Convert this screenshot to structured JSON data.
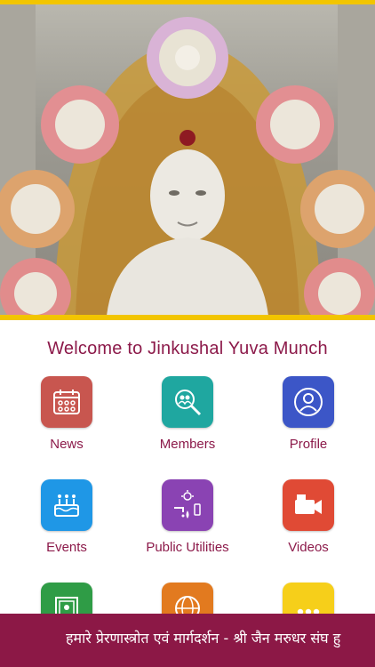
{
  "welcome_title": "Welcome to Jinkushal Yuva Munch",
  "menu": [
    {
      "label": "News",
      "icon": "calendar-icon",
      "color": "#c8564f"
    },
    {
      "label": "Members",
      "icon": "people-search-icon",
      "color": "#1fa7a0"
    },
    {
      "label": "Profile",
      "icon": "user-icon",
      "color": "#3c56c7"
    },
    {
      "label": "Events",
      "icon": "birthday-cake-icon",
      "color": "#1f97e6"
    },
    {
      "label": "Public Utilities",
      "icon": "utilities-icon",
      "color": "#8a43b3"
    },
    {
      "label": "Videos",
      "icon": "video-camera-icon",
      "color": "#e04a35"
    },
    {
      "label": "",
      "icon": "photo-gallery-icon",
      "color": "#2f9c46"
    },
    {
      "label": "",
      "icon": "globe-www-icon",
      "color": "#e27a1f"
    },
    {
      "label": "",
      "icon": "more-dots-icon",
      "color": "#f6cf1a"
    }
  ],
  "ticker_text": "हमारे प्रेरणास्त्रोत एवं मार्गदर्शन - श्री जैन मरुधर संघ हु",
  "accent_color": "#8c1a4a",
  "banner_border_color": "#f2c500"
}
